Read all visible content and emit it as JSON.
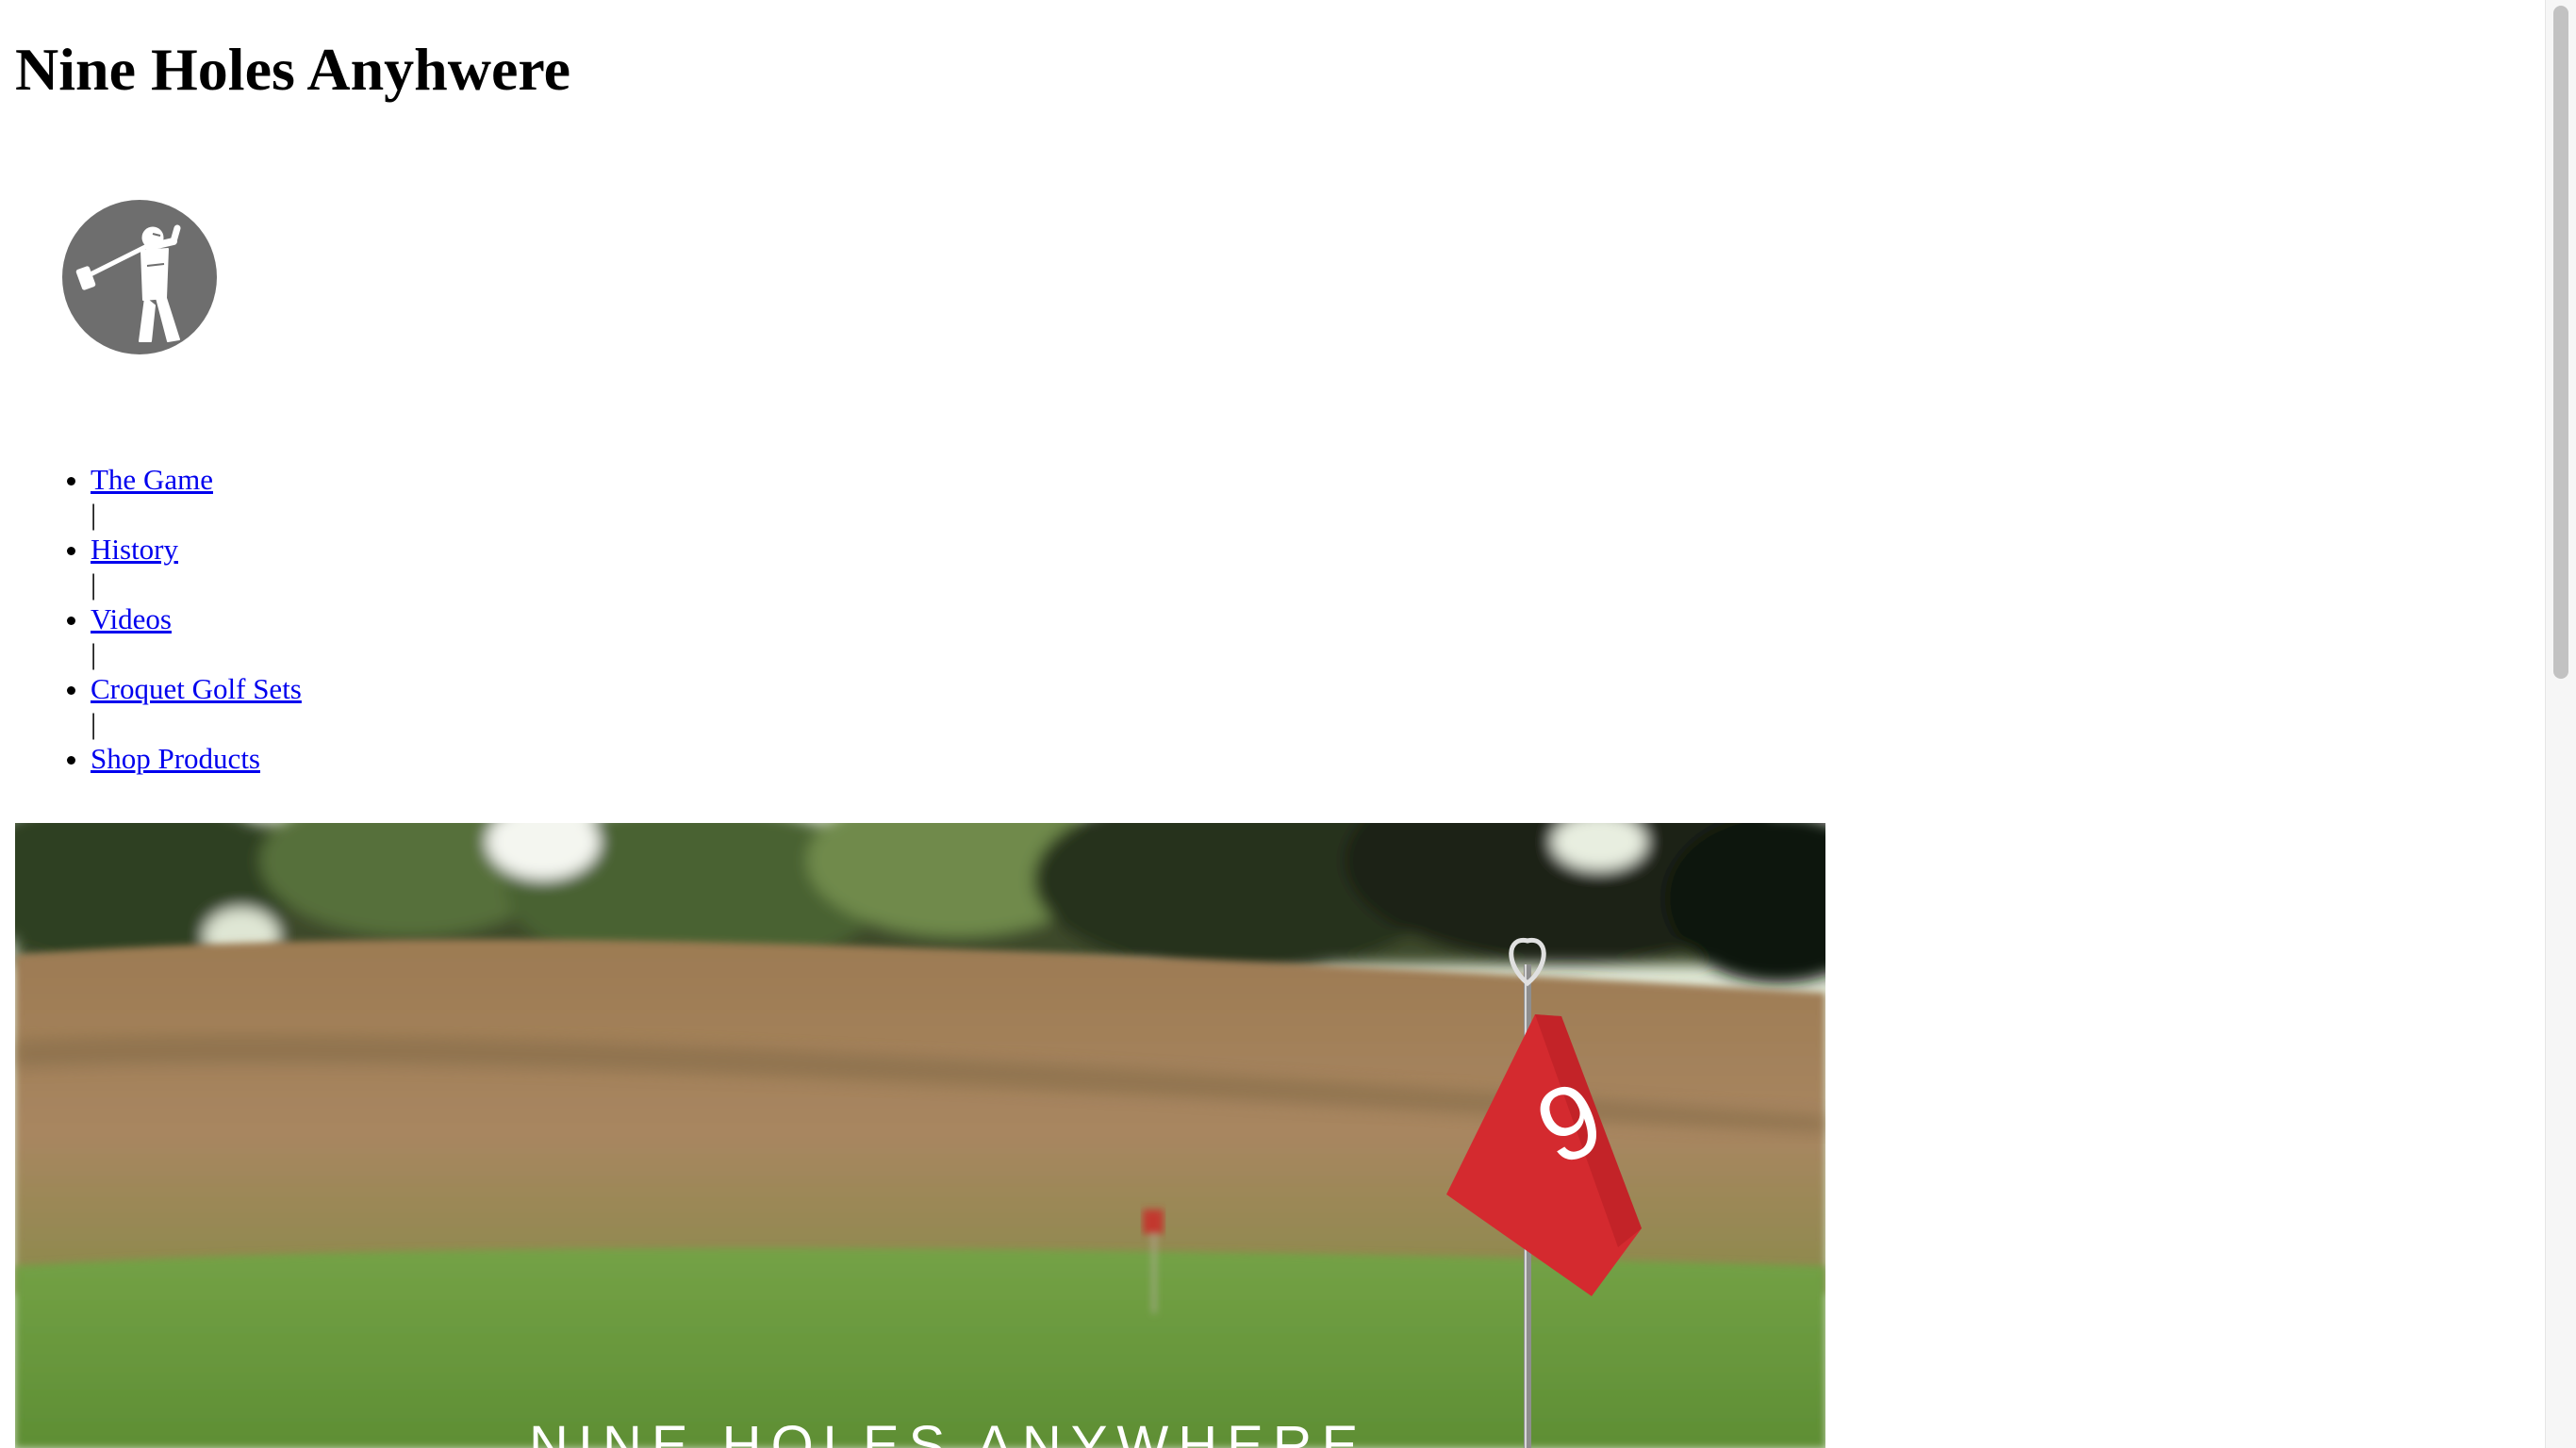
{
  "site": {
    "title": "Nine Holes Anyhwere"
  },
  "logo": {
    "icon": "golfer-swinging-mallet-logo"
  },
  "nav": {
    "items": [
      {
        "label": "The Game"
      },
      {
        "label": "History"
      },
      {
        "label": "Videos"
      },
      {
        "label": "Croquet Golf Sets"
      },
      {
        "label": "Shop Products"
      }
    ],
    "separator": "|"
  },
  "hero": {
    "flag_number": "9",
    "caption": "NINE HOLES ANYWHERE",
    "colors": {
      "flag": "#d42a2f",
      "grass": "#6a9a3e",
      "trees": "#1f2a1a"
    }
  }
}
